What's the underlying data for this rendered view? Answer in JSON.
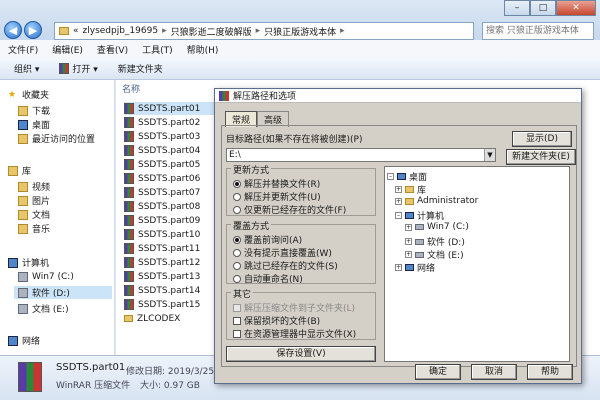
{
  "address": {
    "path": [
      "zlysedpjb_19695",
      "只狼影逝二度破解版",
      "只狼正版游戏本体"
    ],
    "prefix": "«",
    "search_placeholder": "搜索 只狼正版游戏本体"
  },
  "window_controls": {
    "minimize": "–",
    "maximize": "□",
    "close": "✕"
  },
  "menu": [
    "文件(F)",
    "编辑(E)",
    "查看(V)",
    "工具(T)",
    "帮助(H)"
  ],
  "toolbar": {
    "organize": "组织 ▾",
    "open": "打开 ▾",
    "new_folder": "新建文件夹"
  },
  "sidebar": {
    "favorites": "收藏夹",
    "fav_items": [
      "下载",
      "桌面",
      "最近访问的位置"
    ],
    "libraries": "库",
    "lib_items": [
      "视频",
      "图片",
      "文档",
      "音乐"
    ],
    "computer": "计算机",
    "drives": [
      "Win7 (C:)",
      "软件 (D:)",
      "文档 (E:)"
    ],
    "network": "网络"
  },
  "files": {
    "column_name": "名称",
    "items": [
      "SSDTS.part01",
      "SSDTS.part02",
      "SSDTS.part03",
      "SSDTS.part04",
      "SSDTS.part05",
      "SSDTS.part06",
      "SSDTS.part07",
      "SSDTS.part08",
      "SSDTS.part09",
      "SSDTS.part10",
      "SSDTS.part11",
      "SSDTS.part12",
      "SSDTS.part13",
      "SSDTS.part14",
      "SSDTS.part15",
      "ZLCODEX"
    ]
  },
  "details": {
    "name": "SSDTS.part01",
    "type": "WinRAR 压缩文件",
    "modified_label": "修改日期: 2019/3/25 18",
    "size_label": "大小: 0.97 GB"
  },
  "dialog": {
    "title": "解压路径和选项",
    "tabs": [
      "常规",
      "高级"
    ],
    "target_label": "目标路径(如果不存在将被创建)(P)",
    "target_value": "E:\\",
    "show_button": "显示(D)",
    "new_folder_button": "新建文件夹(E)",
    "update_mode": {
      "title": "更新方式",
      "options": [
        "解压并替换文件(R)",
        "解压并更新文件(U)",
        "仅更新已经存在的文件(F)"
      ],
      "selected": 0
    },
    "overwrite_mode": {
      "title": "覆盖方式",
      "options": [
        "覆盖前询问(A)",
        "没有提示直接覆盖(W)",
        "跳过已经存在的文件(S)",
        "自动重命名(N)"
      ],
      "selected": 0
    },
    "misc": {
      "title": "其它",
      "options": [
        "解压压缩文件到子文件夹(L)",
        "保留损坏的文件(B)",
        "在资源管理器中显示文件(X)"
      ]
    },
    "save_button": "保存设置(V)",
    "tree": {
      "desktop": "桌面",
      "library": "库",
      "admin": "Administrator",
      "computer": "计算机",
      "drives": [
        "Win7 (C:)",
        "软件 (D:)",
        "文档 (E:)"
      ],
      "network": "网络"
    },
    "ok": "确定",
    "cancel": "取消",
    "help": "帮助"
  }
}
